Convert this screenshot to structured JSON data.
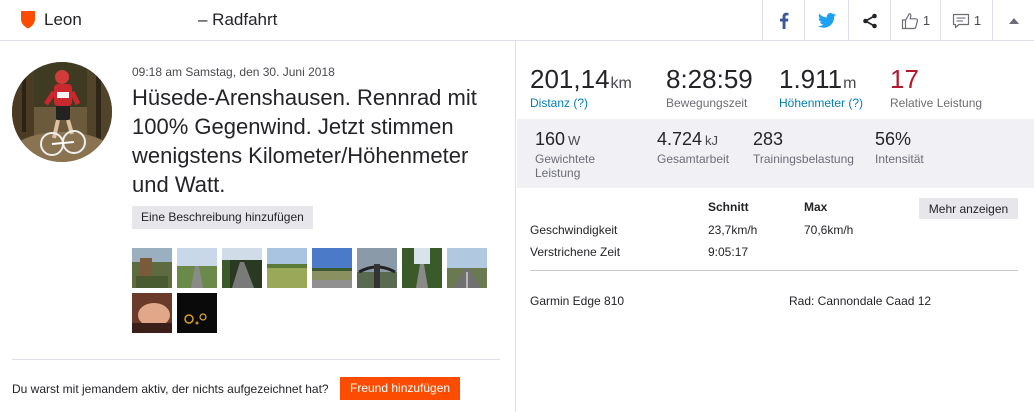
{
  "header": {
    "athlete_name": "Leon",
    "title": "– Radfahrt",
    "kudos_count": "1",
    "comments_count": "1",
    "icons": [
      "shield-icon",
      "facebook-icon",
      "twitter-icon",
      "share-icon",
      "thumbs-up-icon",
      "comment-icon",
      "collapse-icon"
    ],
    "colors": {
      "brand": "#fc4c02",
      "facebook": "#3b5998",
      "twitter": "#1da1f2"
    }
  },
  "activity": {
    "date": "09:18 am Samstag, den 30. Juni 2018",
    "name": "Hüsede-Arenshausen. Rennrad mit 100% Gegenwind. Jetzt stimmen wenigstens Kilometer/Höhenmeter und Watt.",
    "add_description": "Eine Beschreibung hinzufügen",
    "friend_question": "Du warst mit jemandem aktiv, der nichts aufgezeichnet hat?",
    "add_friend": "Freund hinzufügen"
  },
  "stats": {
    "distance": {
      "value": "201,14",
      "unit": "km",
      "label": "Distanz (?)"
    },
    "moving_time": {
      "value": "8:28:59",
      "label": "Bewegungszeit"
    },
    "elevation": {
      "value": "1.911",
      "unit": "m",
      "label": "Höhenmeter (?)"
    },
    "relative_effort": {
      "value": "17",
      "label": "Relative Leistung"
    }
  },
  "power": {
    "weighted": {
      "value": "160",
      "unit": "W",
      "label": "Gewichtete Leistung"
    },
    "work": {
      "value": "4.724",
      "unit": "kJ",
      "label": "Gesamtarbeit"
    },
    "training_load": {
      "value": "283",
      "label": "Trainingsbelastung"
    },
    "intensity": {
      "value": "56%",
      "label": "Intensität"
    }
  },
  "table": {
    "col_avg": "Schnitt",
    "col_max": "Max",
    "more": "Mehr anzeigen",
    "rows": [
      {
        "label": "Geschwindigkeit",
        "avg": "23,7km/h",
        "max": "70,6km/h"
      },
      {
        "label": "Verstrichene Zeit",
        "avg": "9:05:17",
        "max": ""
      }
    ]
  },
  "gear": {
    "device": "Garmin Edge 810",
    "bike": "Rad: Cannondale Caad 12"
  }
}
